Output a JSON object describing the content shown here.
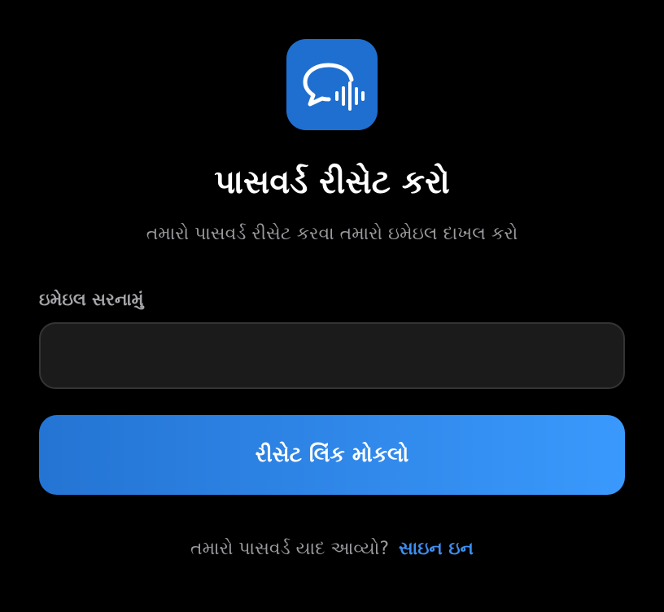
{
  "app_icon": {
    "name": "chat-voice-icon",
    "background": "#1f6fd0"
  },
  "title": "પાસવર્ડ રીસેટ કરો",
  "subtitle": "તમારો પાસવર્ડ રીસેટ કરવા તમારો ઇમેઇલ દાખલ કરો",
  "email": {
    "label": "ઇમેઇલ સરનામું",
    "value": "",
    "placeholder": ""
  },
  "reset_button": {
    "label": "રીસેટ લિંક મોકલો"
  },
  "footer": {
    "prompt": "તમારો પાસવર્ડ યાદ આવ્યો?",
    "signin_label": "સાઇન ઇન"
  },
  "colors": {
    "background": "#000000",
    "accent": "#3a99fd",
    "link": "#3d8ff0",
    "muted_text": "#9a9a9f"
  }
}
